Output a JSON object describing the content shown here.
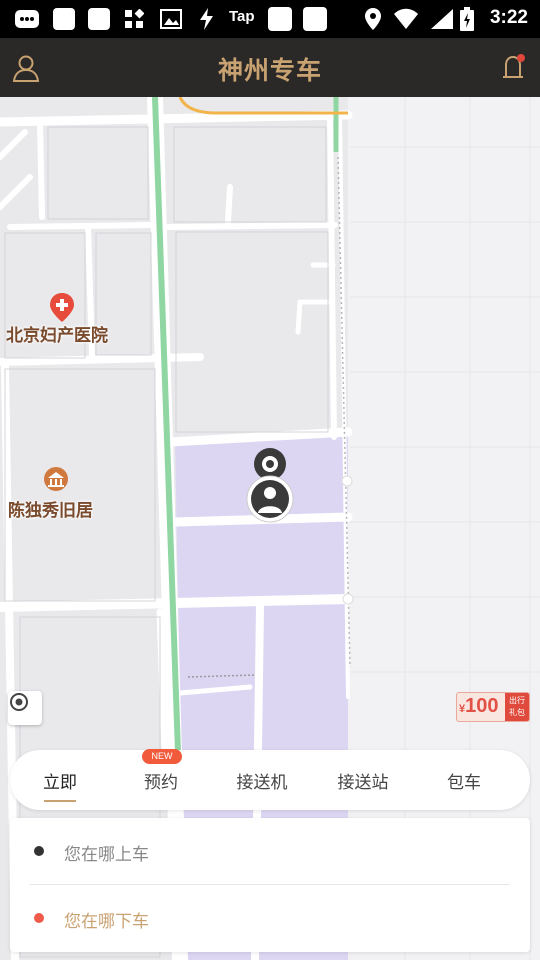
{
  "status_bar": {
    "tap_label": "Tap",
    "time": "3:22"
  },
  "header": {
    "title": "神州专车",
    "profile_icon": "person-icon",
    "notification_icon": "bell-icon",
    "notification_dot_color": "#e0463a"
  },
  "map": {
    "pois": [
      {
        "label": "北京妇产医院",
        "icon": "hospital-pin-icon"
      },
      {
        "label": "陈独秀旧居",
        "icon": "museum-pin-icon"
      }
    ],
    "gift_badge": {
      "currency": "¥",
      "amount": "100",
      "tag_line1": "出行",
      "tag_line2": "礼包"
    },
    "colors": {
      "district_fill": "#ddd6f3",
      "green_road": "#8fd6a3",
      "orange_road": "#f2b44a"
    }
  },
  "tabs": {
    "items": [
      "立即",
      "预约",
      "接送机",
      "接送站",
      "包车"
    ],
    "active_index": 0,
    "new_badge": "NEW",
    "accent": "#c9a271"
  },
  "address": {
    "pickup_placeholder": "您在哪上车",
    "dropoff_placeholder": "您在哪下车",
    "pickup_dot_color": "#333333",
    "dropoff_dot_color": "#f05a4a",
    "dropoff_text_color": "#c9a271"
  }
}
